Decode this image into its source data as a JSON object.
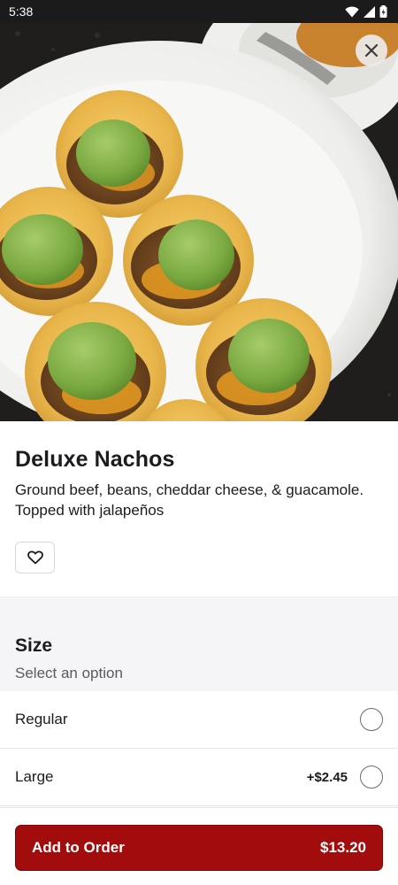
{
  "status_bar": {
    "time": "5:38"
  },
  "item": {
    "name": "Deluxe Nachos",
    "description": "Ground beef, beans, cheddar cheese, & guacamole. Topped with jalapeños"
  },
  "options": {
    "title": "Size",
    "subtitle": "Select an option",
    "choices": [
      {
        "label": "Regular",
        "price": ""
      },
      {
        "label": "Large",
        "price": "+$2.45"
      }
    ]
  },
  "footer": {
    "add_label": "Add to Order",
    "total": "$13.20"
  },
  "colors": {
    "accent": "#a30c0c",
    "status_bar": "#1b1b1b",
    "section_bg": "#f5f5f7"
  },
  "icons": {
    "close": "close-icon",
    "favorite": "heart-outline-icon",
    "wifi": "wifi-icon",
    "signal": "signal-icon",
    "battery": "battery-icon"
  }
}
